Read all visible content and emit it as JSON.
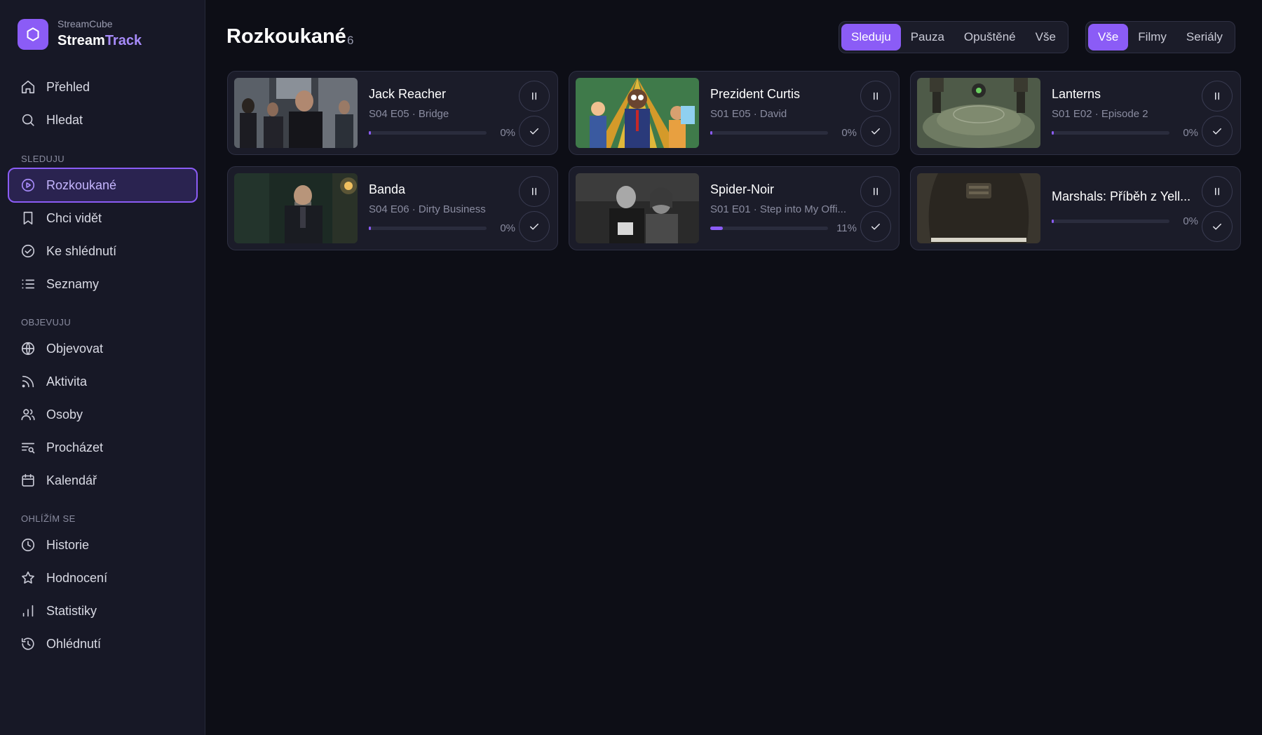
{
  "brand": {
    "org": "StreamCube",
    "name_main": "Stream",
    "name_accent": "Track"
  },
  "colors": {
    "accent": "#8b5cf6",
    "background": "#0d0e16",
    "sidebar": "#171826",
    "card": "#1b1c29"
  },
  "nav": {
    "top": [
      {
        "label": "Přehled",
        "icon": "home-icon"
      },
      {
        "label": "Hledat",
        "icon": "search-icon"
      }
    ],
    "sections": [
      {
        "title": "SLEDUJU",
        "items": [
          {
            "label": "Rozkoukané",
            "icon": "play-circle-icon",
            "active": true
          },
          {
            "label": "Chci vidět",
            "icon": "bookmark-icon"
          },
          {
            "label": "Ke shlédnutí",
            "icon": "check-circle-icon"
          },
          {
            "label": "Seznamy",
            "icon": "list-icon"
          }
        ]
      },
      {
        "title": "OBJEVUJU",
        "items": [
          {
            "label": "Objevovat",
            "icon": "globe-icon"
          },
          {
            "label": "Aktivita",
            "icon": "rss-icon"
          },
          {
            "label": "Osoby",
            "icon": "users-icon"
          },
          {
            "label": "Procházet",
            "icon": "browse-icon"
          },
          {
            "label": "Kalendář",
            "icon": "calendar-icon"
          }
        ]
      },
      {
        "title": "OHLÍŽÍM SE",
        "items": [
          {
            "label": "Historie",
            "icon": "clock-icon"
          },
          {
            "label": "Hodnocení",
            "icon": "star-icon"
          },
          {
            "label": "Statistiky",
            "icon": "bar-chart-icon"
          },
          {
            "label": "Ohlédnutí",
            "icon": "history-icon"
          }
        ]
      }
    ]
  },
  "header": {
    "title": "Rozkoukané",
    "count": "6"
  },
  "status_filter": {
    "options": [
      "Sleduju",
      "Pauza",
      "Opuštěné",
      "Vše"
    ],
    "selected": "Sleduju"
  },
  "type_filter": {
    "options": [
      "Vše",
      "Filmy",
      "Seriály"
    ],
    "selected": "Vše"
  },
  "cards": [
    {
      "title": "Jack Reacher",
      "subtitle": "S04 E05 · Bridge",
      "progress": 0,
      "progress_label": "0%"
    },
    {
      "title": "Prezident Curtis",
      "subtitle": "S01 E05 · David",
      "progress": 0,
      "progress_label": "0%"
    },
    {
      "title": "Lanterns",
      "subtitle": "S01 E02 · Episode 2",
      "progress": 0,
      "progress_label": "0%"
    },
    {
      "title": "Banda",
      "subtitle": "S04 E06 · Dirty Business",
      "progress": 0,
      "progress_label": "0%"
    },
    {
      "title": "Spider-Noir",
      "subtitle": "S01 E01 · Step into My Offi...",
      "progress": 11,
      "progress_label": "11%"
    },
    {
      "title": "Marshals: Příběh z Yell...",
      "subtitle": "",
      "progress": 0,
      "progress_label": "0%"
    }
  ]
}
